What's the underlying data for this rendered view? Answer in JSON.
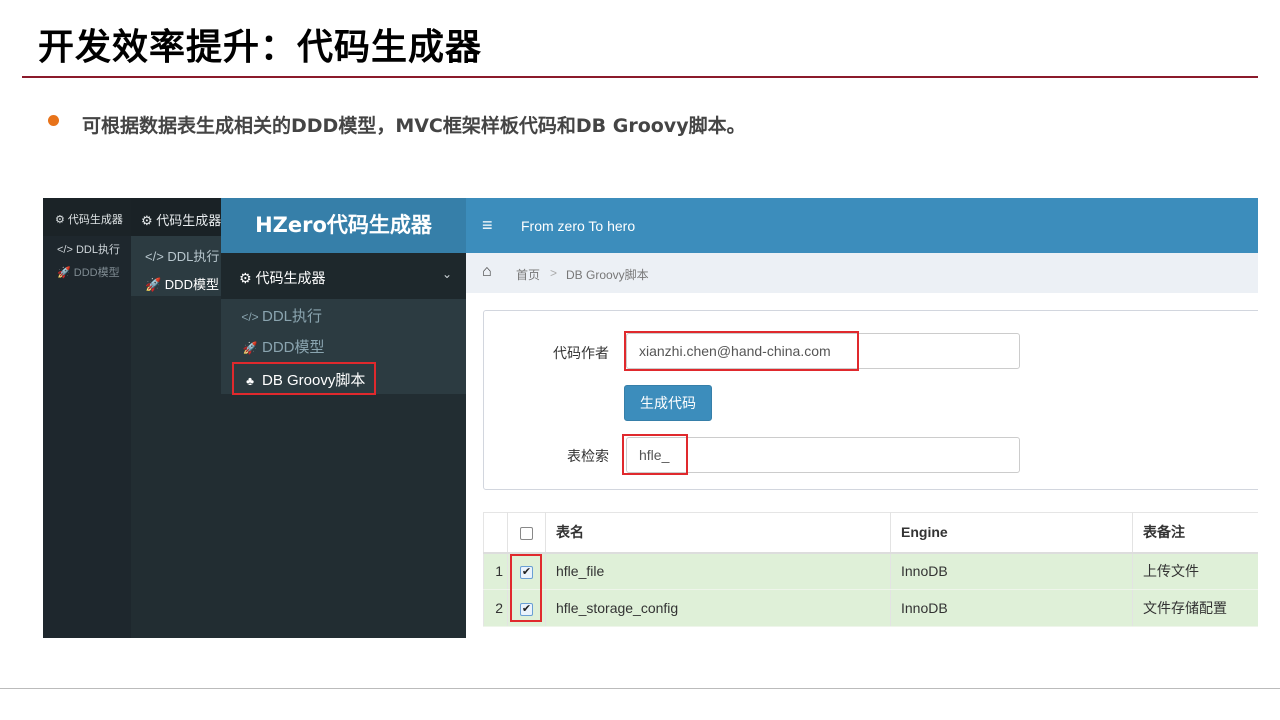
{
  "slide": {
    "title": "开发效率提升：代码生成器",
    "bullet": "可根据数据表生成相关的DDD模型，MVC框架样板代码和DB Groovy脚本。"
  },
  "layer1": {
    "header": "⚙ 代码生成器",
    "items": [
      "</> DDL执行",
      "🚀 DDD模型"
    ]
  },
  "layer2": {
    "header": "⚙ 代码生成器",
    "items": [
      "</> DDL执行",
      "🚀 DDD模型"
    ]
  },
  "sidebar": {
    "logo": "HZero代码生成器",
    "menu_header": "代码生成器",
    "items": [
      {
        "icon": "</>",
        "label": "DDL执行"
      },
      {
        "icon": "🚀",
        "label": "DDD模型"
      },
      {
        "icon": "♣",
        "label": "DB Groovy脚本"
      }
    ]
  },
  "topbar": {
    "tagline": "From zero To hero"
  },
  "breadcrumb": {
    "home": "首页",
    "separator": ">",
    "current": "DB Groovy脚本"
  },
  "form": {
    "author_label": "代码作者",
    "author_value": "xianzhi.chen@hand-china.com",
    "generate_label": "生成代码",
    "search_label": "表检索",
    "search_value": "hfle_"
  },
  "table": {
    "headers": [
      "表名",
      "Engine",
      "表备注"
    ],
    "rows": [
      {
        "index": "1",
        "checked": true,
        "name": "hfle_file",
        "engine": "InnoDB",
        "comment": "上传文件"
      },
      {
        "index": "2",
        "checked": true,
        "name": "hfle_storage_config",
        "engine": "InnoDB",
        "comment": "文件存储配置"
      }
    ]
  },
  "colors": {
    "accent": "#3c8dbc",
    "sidebar": "#222d32",
    "highlight": "#e0292d",
    "title_rule": "#8b1a2b",
    "bullet": "#e8731a",
    "selected_row": "#dff0d8"
  }
}
